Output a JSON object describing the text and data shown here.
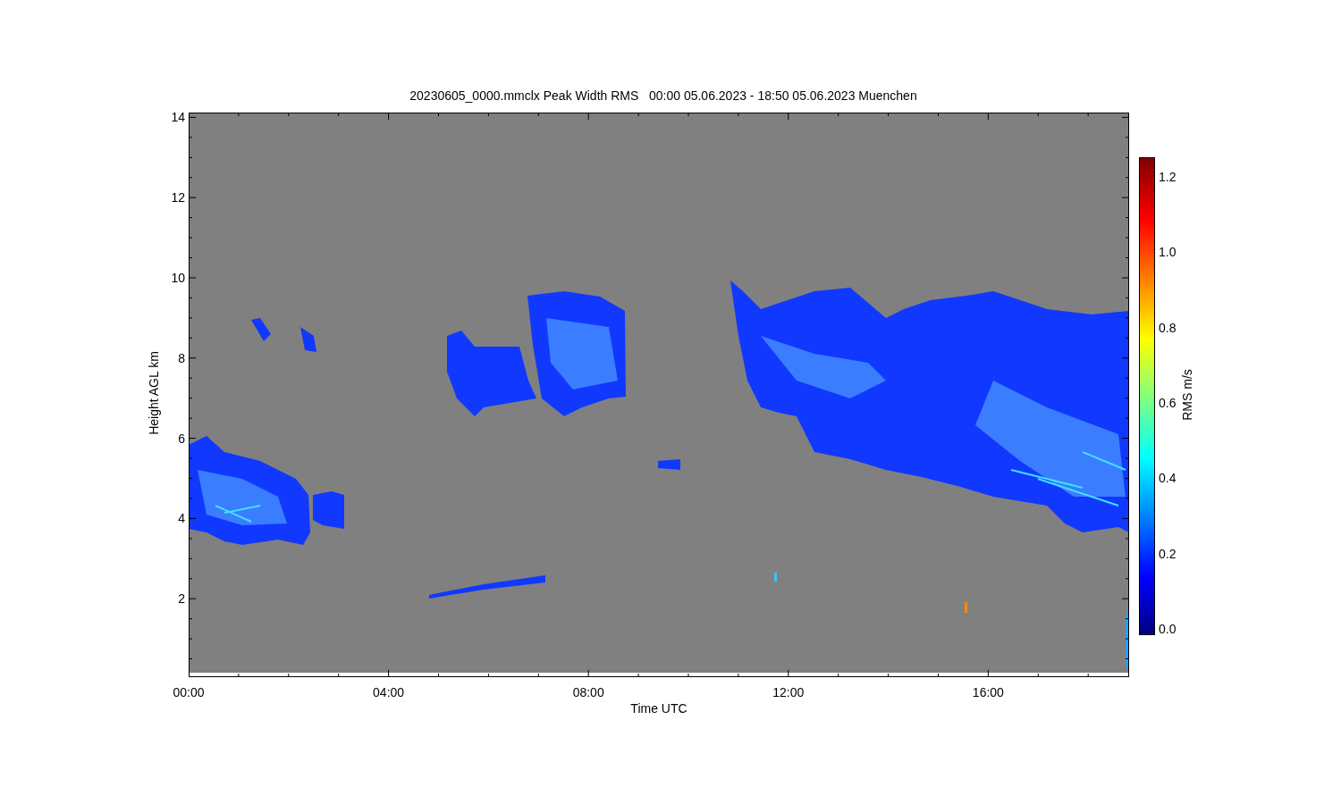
{
  "title": "20230605_0000.mmclx Peak Width RMS   00:00 05.06.2023 - 18:50 05.06.2023 Muenchen",
  "y_axis": {
    "label": "Height AGL km",
    "ticks": [
      "14",
      "12",
      "10",
      "8",
      "6",
      "4",
      "2"
    ]
  },
  "x_axis": {
    "label": "Time UTC",
    "ticks": [
      "00:00",
      "04:00",
      "08:00",
      "12:00",
      "16:00"
    ]
  },
  "colorbar": {
    "label": "RMS m/s",
    "ticks": [
      "1.2",
      "1.0",
      "0.8",
      "0.6",
      "0.4",
      "0.2",
      "0.0"
    ]
  }
}
